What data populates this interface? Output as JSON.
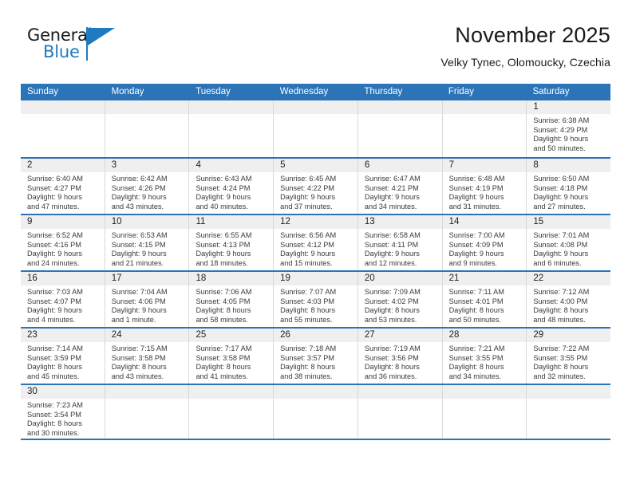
{
  "brand": {
    "name_part1": "General",
    "name_part2": "Blue",
    "flag_icon": "blue-flag-triangle",
    "accent_color": "#1f7ac0"
  },
  "header": {
    "title": "November 2025",
    "subtitle": "Velky Tynec, Olomoucky, Czechia"
  },
  "colors": {
    "header_blue": "#2b74b8",
    "daynum_band": "#efefef",
    "text": "#222222"
  },
  "calendar": {
    "day_headers": [
      "Sunday",
      "Monday",
      "Tuesday",
      "Wednesday",
      "Thursday",
      "Friday",
      "Saturday"
    ],
    "weeks": [
      [
        {
          "day": "",
          "lines": []
        },
        {
          "day": "",
          "lines": []
        },
        {
          "day": "",
          "lines": []
        },
        {
          "day": "",
          "lines": []
        },
        {
          "day": "",
          "lines": []
        },
        {
          "day": "",
          "lines": []
        },
        {
          "day": "1",
          "lines": [
            "Sunrise: 6:38 AM",
            "Sunset: 4:29 PM",
            "Daylight: 9 hours",
            "and 50 minutes."
          ]
        }
      ],
      [
        {
          "day": "2",
          "lines": [
            "Sunrise: 6:40 AM",
            "Sunset: 4:27 PM",
            "Daylight: 9 hours",
            "and 47 minutes."
          ]
        },
        {
          "day": "3",
          "lines": [
            "Sunrise: 6:42 AM",
            "Sunset: 4:26 PM",
            "Daylight: 9 hours",
            "and 43 minutes."
          ]
        },
        {
          "day": "4",
          "lines": [
            "Sunrise: 6:43 AM",
            "Sunset: 4:24 PM",
            "Daylight: 9 hours",
            "and 40 minutes."
          ]
        },
        {
          "day": "5",
          "lines": [
            "Sunrise: 6:45 AM",
            "Sunset: 4:22 PM",
            "Daylight: 9 hours",
            "and 37 minutes."
          ]
        },
        {
          "day": "6",
          "lines": [
            "Sunrise: 6:47 AM",
            "Sunset: 4:21 PM",
            "Daylight: 9 hours",
            "and 34 minutes."
          ]
        },
        {
          "day": "7",
          "lines": [
            "Sunrise: 6:48 AM",
            "Sunset: 4:19 PM",
            "Daylight: 9 hours",
            "and 31 minutes."
          ]
        },
        {
          "day": "8",
          "lines": [
            "Sunrise: 6:50 AM",
            "Sunset: 4:18 PM",
            "Daylight: 9 hours",
            "and 27 minutes."
          ]
        }
      ],
      [
        {
          "day": "9",
          "lines": [
            "Sunrise: 6:52 AM",
            "Sunset: 4:16 PM",
            "Daylight: 9 hours",
            "and 24 minutes."
          ]
        },
        {
          "day": "10",
          "lines": [
            "Sunrise: 6:53 AM",
            "Sunset: 4:15 PM",
            "Daylight: 9 hours",
            "and 21 minutes."
          ]
        },
        {
          "day": "11",
          "lines": [
            "Sunrise: 6:55 AM",
            "Sunset: 4:13 PM",
            "Daylight: 9 hours",
            "and 18 minutes."
          ]
        },
        {
          "day": "12",
          "lines": [
            "Sunrise: 6:56 AM",
            "Sunset: 4:12 PM",
            "Daylight: 9 hours",
            "and 15 minutes."
          ]
        },
        {
          "day": "13",
          "lines": [
            "Sunrise: 6:58 AM",
            "Sunset: 4:11 PM",
            "Daylight: 9 hours",
            "and 12 minutes."
          ]
        },
        {
          "day": "14",
          "lines": [
            "Sunrise: 7:00 AM",
            "Sunset: 4:09 PM",
            "Daylight: 9 hours",
            "and 9 minutes."
          ]
        },
        {
          "day": "15",
          "lines": [
            "Sunrise: 7:01 AM",
            "Sunset: 4:08 PM",
            "Daylight: 9 hours",
            "and 6 minutes."
          ]
        }
      ],
      [
        {
          "day": "16",
          "lines": [
            "Sunrise: 7:03 AM",
            "Sunset: 4:07 PM",
            "Daylight: 9 hours",
            "and 4 minutes."
          ]
        },
        {
          "day": "17",
          "lines": [
            "Sunrise: 7:04 AM",
            "Sunset: 4:06 PM",
            "Daylight: 9 hours",
            "and 1 minute."
          ]
        },
        {
          "day": "18",
          "lines": [
            "Sunrise: 7:06 AM",
            "Sunset: 4:05 PM",
            "Daylight: 8 hours",
            "and 58 minutes."
          ]
        },
        {
          "day": "19",
          "lines": [
            "Sunrise: 7:07 AM",
            "Sunset: 4:03 PM",
            "Daylight: 8 hours",
            "and 55 minutes."
          ]
        },
        {
          "day": "20",
          "lines": [
            "Sunrise: 7:09 AM",
            "Sunset: 4:02 PM",
            "Daylight: 8 hours",
            "and 53 minutes."
          ]
        },
        {
          "day": "21",
          "lines": [
            "Sunrise: 7:11 AM",
            "Sunset: 4:01 PM",
            "Daylight: 8 hours",
            "and 50 minutes."
          ]
        },
        {
          "day": "22",
          "lines": [
            "Sunrise: 7:12 AM",
            "Sunset: 4:00 PM",
            "Daylight: 8 hours",
            "and 48 minutes."
          ]
        }
      ],
      [
        {
          "day": "23",
          "lines": [
            "Sunrise: 7:14 AM",
            "Sunset: 3:59 PM",
            "Daylight: 8 hours",
            "and 45 minutes."
          ]
        },
        {
          "day": "24",
          "lines": [
            "Sunrise: 7:15 AM",
            "Sunset: 3:58 PM",
            "Daylight: 8 hours",
            "and 43 minutes."
          ]
        },
        {
          "day": "25",
          "lines": [
            "Sunrise: 7:17 AM",
            "Sunset: 3:58 PM",
            "Daylight: 8 hours",
            "and 41 minutes."
          ]
        },
        {
          "day": "26",
          "lines": [
            "Sunrise: 7:18 AM",
            "Sunset: 3:57 PM",
            "Daylight: 8 hours",
            "and 38 minutes."
          ]
        },
        {
          "day": "27",
          "lines": [
            "Sunrise: 7:19 AM",
            "Sunset: 3:56 PM",
            "Daylight: 8 hours",
            "and 36 minutes."
          ]
        },
        {
          "day": "28",
          "lines": [
            "Sunrise: 7:21 AM",
            "Sunset: 3:55 PM",
            "Daylight: 8 hours",
            "and 34 minutes."
          ]
        },
        {
          "day": "29",
          "lines": [
            "Sunrise: 7:22 AM",
            "Sunset: 3:55 PM",
            "Daylight: 8 hours",
            "and 32 minutes."
          ]
        }
      ],
      [
        {
          "day": "30",
          "lines": [
            "Sunrise: 7:23 AM",
            "Sunset: 3:54 PM",
            "Daylight: 8 hours",
            "and 30 minutes."
          ]
        },
        {
          "day": "",
          "lines": []
        },
        {
          "day": "",
          "lines": []
        },
        {
          "day": "",
          "lines": []
        },
        {
          "day": "",
          "lines": []
        },
        {
          "day": "",
          "lines": []
        },
        {
          "day": "",
          "lines": []
        }
      ]
    ]
  }
}
